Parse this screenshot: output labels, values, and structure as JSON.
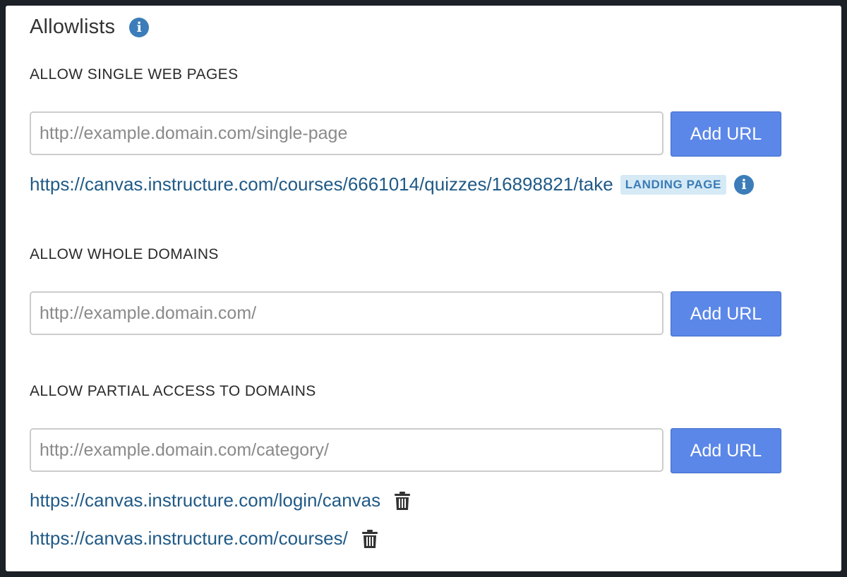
{
  "header": {
    "title": "Allowlists"
  },
  "sections": [
    {
      "label": "ALLOW SINGLE WEB PAGES",
      "placeholder": "http://example.domain.com/single-page",
      "button_label": "Add URL",
      "entries": [
        {
          "url": "https://canvas.instructure.com/courses/6661014/quizzes/16898821/take",
          "badge": "LANDING PAGE"
        }
      ]
    },
    {
      "label": "ALLOW WHOLE DOMAINS",
      "placeholder": "http://example.domain.com/",
      "button_label": "Add URL",
      "entries": []
    },
    {
      "label": "ALLOW PARTIAL ACCESS TO DOMAINS",
      "placeholder": "http://example.domain.com/category/",
      "button_label": "Add URL",
      "entries": [
        {
          "url": "https://canvas.instructure.com/login/canvas"
        },
        {
          "url": "https://canvas.instructure.com/courses/"
        }
      ]
    }
  ],
  "icons": {
    "info": "info-icon",
    "delete": "trash-icon"
  },
  "colors": {
    "accent_button": "#5b87e8",
    "link": "#205a87",
    "info_icon": "#3c7db9",
    "badge_bg": "#d6eaf6",
    "badge_text": "#3a7bb5"
  }
}
